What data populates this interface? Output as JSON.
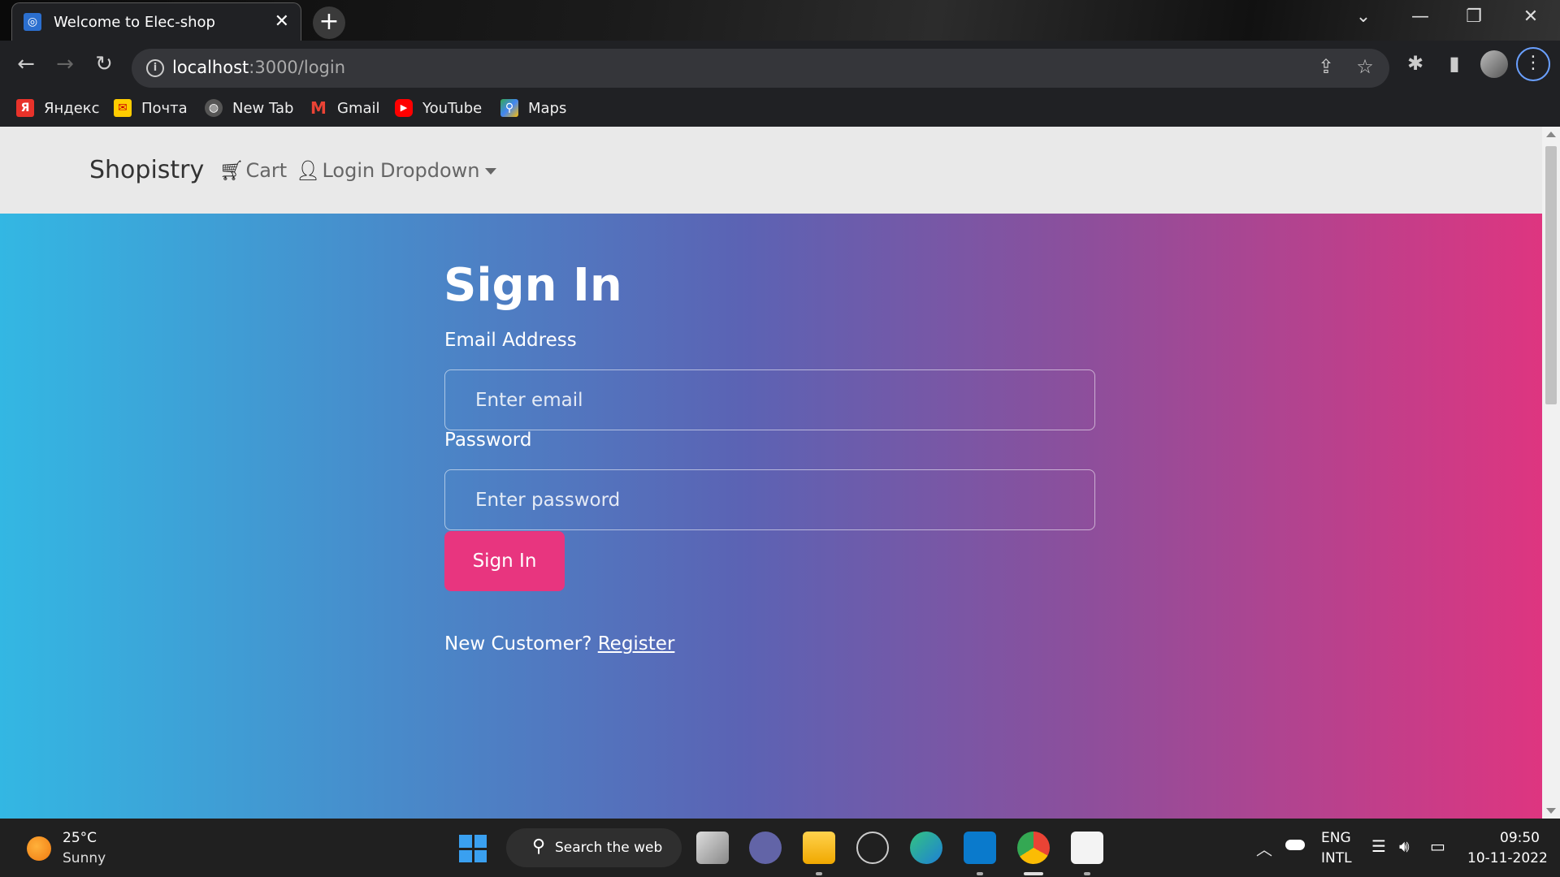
{
  "browser": {
    "tab_title": "Welcome to Elec-shop",
    "tab_close": "✕",
    "new_tab": "+",
    "url_host": "localhost",
    "url_path": ":3000/login",
    "bookmarks": [
      {
        "label": "Яндекс",
        "icon": "yandex-icon",
        "color": "#e8322a"
      },
      {
        "label": "Почта",
        "icon": "mail-icon",
        "color": "#ffcc00"
      },
      {
        "label": "New Tab",
        "icon": "globe-icon",
        "color": "#888888"
      },
      {
        "label": "Gmail",
        "icon": "gmail-icon",
        "color": "#ea4335"
      },
      {
        "label": "YouTube",
        "icon": "youtube-icon",
        "color": "#ff0000"
      },
      {
        "label": "Maps",
        "icon": "maps-icon",
        "color": "#34a853"
      }
    ]
  },
  "navbar": {
    "brand": "Shopistry",
    "cart": "Cart",
    "login": "Login",
    "dropdown": "Dropdown"
  },
  "form": {
    "title": "Sign In",
    "email_label": "Email Address",
    "email_placeholder": "Enter email",
    "email_value": "",
    "password_label": "Password",
    "password_placeholder": "Enter password",
    "password_value": "",
    "submit": "Sign In",
    "new_customer": "New Customer? ",
    "register": "Register"
  },
  "colors": {
    "gradient_start": "#33b7e3",
    "gradient_end": "#de3580",
    "button": "#e8357f",
    "navbar_bg": "#e9e9e9"
  },
  "taskbar": {
    "temperature": "25°C",
    "weather": "Sunny",
    "search": "Search the web",
    "lang_top": "ENG",
    "lang_bottom": "INTL",
    "time": "09:50",
    "date": "10-11-2022"
  }
}
